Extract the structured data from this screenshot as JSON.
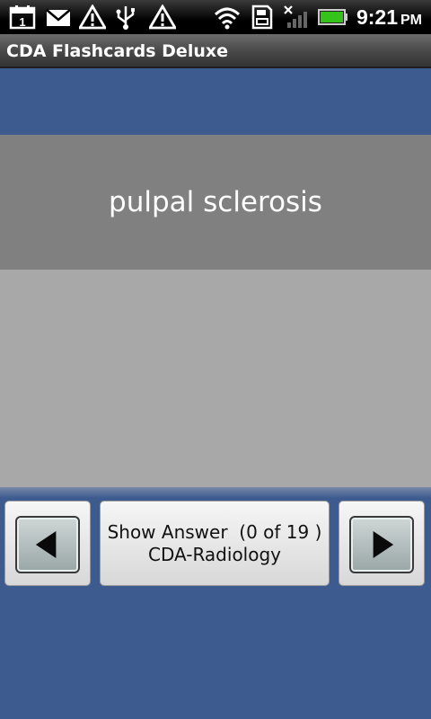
{
  "status_bar": {
    "calendar_day": "1",
    "time": "9:21",
    "ampm": "PM",
    "icons": [
      "calendar-icon",
      "mail-icon",
      "warning-icon",
      "usb-icon",
      "warning-icon",
      "wifi-icon",
      "sd-card-icon",
      "signal-off-icon",
      "battery-icon"
    ]
  },
  "app": {
    "title": "CDA Flashcards Deluxe"
  },
  "card": {
    "term": "pulpal sclerosis"
  },
  "controls": {
    "answer_line1": "Show Answer  (0 of 19 )",
    "answer_line2": "CDA-Radiology"
  },
  "colors": {
    "background": "#3d5b8f",
    "card_front": "#808080",
    "card_back": "#a8a8a8"
  }
}
